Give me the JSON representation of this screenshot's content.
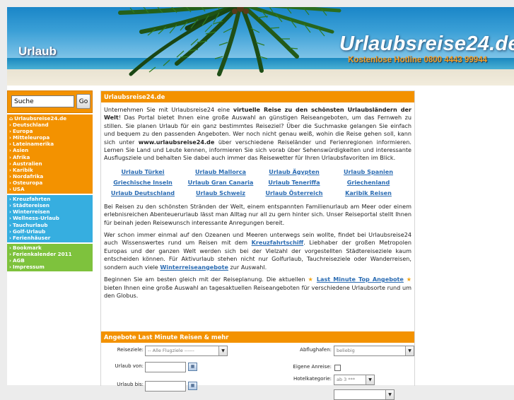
{
  "header": {
    "section_word": "Urlaub",
    "brand": "Urlaubsreise24.de",
    "hotline": "Kostenlose Hotline 0800 4443 99944"
  },
  "search": {
    "value": "Suche",
    "button_label": "Go"
  },
  "nav_groups": [
    {
      "color": "#f39200",
      "items": [
        {
          "arrow": "⌂",
          "label": "Urlaubsreise24.de"
        },
        {
          "arrow": "›",
          "label": "Deutschland"
        },
        {
          "arrow": "›",
          "label": "Europa"
        },
        {
          "arrow": "›",
          "label": "Mitteleuropa"
        },
        {
          "arrow": "›",
          "label": "Lateinamerika"
        },
        {
          "arrow": "›",
          "label": "Asien"
        },
        {
          "arrow": "›",
          "label": "Afrika"
        },
        {
          "arrow": "›",
          "label": "Australien"
        },
        {
          "arrow": "›",
          "label": "Karibik"
        },
        {
          "arrow": "›",
          "label": "Nordafrika"
        },
        {
          "arrow": "›",
          "label": "Osteuropa"
        },
        {
          "arrow": "›",
          "label": "USA"
        }
      ]
    },
    {
      "color": "#36aee0",
      "items": [
        {
          "arrow": "›",
          "label": "Kreuzfahrten"
        },
        {
          "arrow": "›",
          "label": "Städtereisen"
        },
        {
          "arrow": "›",
          "label": "Winterreisen"
        },
        {
          "arrow": "›",
          "label": "Wellness-Urlaub"
        },
        {
          "arrow": "›",
          "label": "Tauchurlaub"
        },
        {
          "arrow": "›",
          "label": "Golf-Urlaub"
        },
        {
          "arrow": "›",
          "label": "Ferienhäuser"
        }
      ]
    },
    {
      "color": "#7ec23d",
      "items": [
        {
          "arrow": "›",
          "label": "Bookmark"
        },
        {
          "arrow": "›",
          "label": "Ferienkalender 2011"
        },
        {
          "arrow": "›",
          "label": "AGB"
        },
        {
          "arrow": "›",
          "label": "Impressum"
        }
      ]
    }
  ],
  "main": {
    "title": "Urlaubsreise24.de",
    "p1": {
      "a": "Unternehmen Sie mit Urlaubsreise24 eine ",
      "b": "virtuelle Reise zu den schönsten Urlaubsländern der Welt",
      "c": "! Das Portal bietet Ihnen eine große Auswahl an günstigen Reiseangeboten, um das Fernweh zu stillen. Sie planen Urlaub für ein ganz bestimmtes Reiseziel? Über die Suchmaske gelangen Sie einfach und bequem zu den passenden Angeboten. Wer noch nicht genau weiß, wohin die Reise gehen soll, kann sich unter ",
      "d": "www.urlaubsreise24.de",
      "e": " über verschiedene Reiseländer und Ferienregionen informieren. Lernen Sie Land und Leute kennen, informieren Sie sich vorab über Sehenswürdigkeiten und interessante Ausflugsziele und behalten Sie dabei auch immer das Reisewetter für Ihren Urlaubsfavoriten im Blick."
    },
    "links": [
      "Urlaub Türkei",
      "Urlaub Mallorca",
      "Urlaub Ägypten",
      "Urlaub Spanien",
      "Griechische Inseln",
      "Urlaub Gran Canaria",
      "Urlaub Teneriffa",
      "Griechenland",
      "Urlaub Deutschland",
      "Urlaub Schweiz",
      "Urlaub Österreich",
      "Karibik Reisen"
    ],
    "p2": "Bei Reisen zu den schönsten Stränden der Welt, einem entspannten Familienurlaub am Meer oder einem erlebnisreichen Abenteuerurlaub lässt man Alltag nur all zu gern hinter sich. Unser Reiseportal stellt Ihnen für beinah jeden Reisewunsch interessante Anregungen bereit.",
    "p3": {
      "a": "Wer schon immer einmal auf den Ozeanen und Meeren unterwegs sein wollte, findet bei Urlaubsreise24 auch Wissenswertes rund um Reisen mit dem ",
      "link1": "Kreuzfahrtschiff",
      "b": ". Liebhaber der großen Metropolen Europas und der ganzen Welt werden sich bei der Vielzahl der vorgestellten Städtereiseziele kaum entscheiden können. Für Aktivurlaub stehen nicht nur Golfurlaub, Tauchreiseziele oder Wanderreisen, sondern auch viele ",
      "link2": "Winterreiseangebote",
      "c": " zur Auswahl."
    },
    "p4": {
      "a": "Beginnen Sie am besten gleich mit der Reiseplanung. Die aktuellen ",
      "link": "Last Minute Top Angebote",
      "b": " bieten Ihnen eine große Auswahl an tagesaktuellen Reiseangeboten für verschiedene Urlaubsorte rund um den Globus."
    }
  },
  "offers": {
    "title": "Angebote Last Minute Reisen & mehr",
    "reiseziele_label": "Reiseziele:",
    "reiseziele_value": "-- Alle Flugziele ------",
    "abflughafen_label": "Abflughafen:",
    "abflughafen_value": "beliebig",
    "urlaub_von_label": "Urlaub von:",
    "eigene_anreise_label": "Eigene Anreise:",
    "hotelkategorie_label": "Hotelkategorie:",
    "hotelkategorie_value": "ab 3 ***",
    "urlaub_bis_label": "Urlaub bis:",
    "dropdown_glyph": "▼",
    "calendar_glyph": "▦"
  }
}
